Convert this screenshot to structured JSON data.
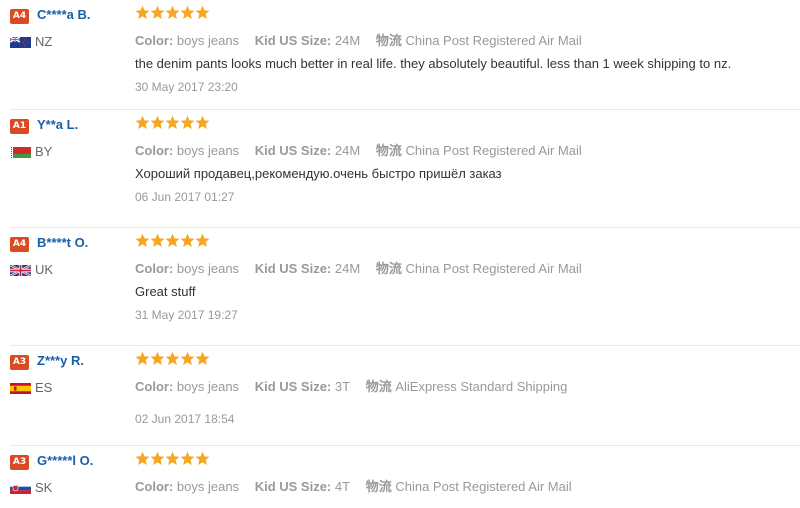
{
  "colors": {
    "level_badge": "#d94b22",
    "name": "#1a5ea8",
    "star": "#f5a623",
    "muted": "#999999"
  },
  "reviews": [
    {
      "level": "A4",
      "name": "C****a B.",
      "country": "NZ",
      "flag_icon": "new-zealand-flag-icon",
      "rating": 5,
      "color_label": "Color:",
      "color_value": "boys jeans",
      "size_label": "Kid US Size:",
      "size_value": "24M",
      "ship_label": "物流",
      "ship_value": "China Post Registered Air Mail",
      "text": "the denim pants looks much better in real life. they absolutely beautiful. less than 1 week shipping to nz.",
      "date": "30 May 2017 23:20"
    },
    {
      "level": "A1",
      "name": "Y**a L.",
      "country": "BY",
      "flag_icon": "belarus-flag-icon",
      "rating": 5,
      "color_label": "Color:",
      "color_value": "boys jeans",
      "size_label": "Kid US Size:",
      "size_value": "24M",
      "ship_label": "物流",
      "ship_value": "China Post Registered Air Mail",
      "text": "Хороший продавец,рекомендую.очень быстро пришёл заказ",
      "date": "06 Jun 2017 01:27"
    },
    {
      "level": "A4",
      "name": "B****t O.",
      "country": "UK",
      "flag_icon": "uk-flag-icon",
      "rating": 5,
      "color_label": "Color:",
      "color_value": "boys jeans",
      "size_label": "Kid US Size:",
      "size_value": "24M",
      "ship_label": "物流",
      "ship_value": "China Post Registered Air Mail",
      "text": "Great stuff",
      "date": "31 May 2017 19:27"
    },
    {
      "level": "A3",
      "name": "Z***y R.",
      "country": "ES",
      "flag_icon": "spain-flag-icon",
      "rating": 5,
      "color_label": "Color:",
      "color_value": "boys jeans",
      "size_label": "Kid US Size:",
      "size_value": "3T",
      "ship_label": "物流",
      "ship_value": "AliExpress Standard Shipping",
      "text": "",
      "date": "02 Jun 2017 18:54"
    },
    {
      "level": "A3",
      "name": "G*****l O.",
      "country": "SK",
      "flag_icon": "slovakia-flag-icon",
      "rating": 5,
      "color_label": "Color:",
      "color_value": "boys jeans",
      "size_label": "Kid US Size:",
      "size_value": "4T",
      "ship_label": "物流",
      "ship_value": "China Post Registered Air Mail",
      "text": "",
      "date": ""
    }
  ]
}
